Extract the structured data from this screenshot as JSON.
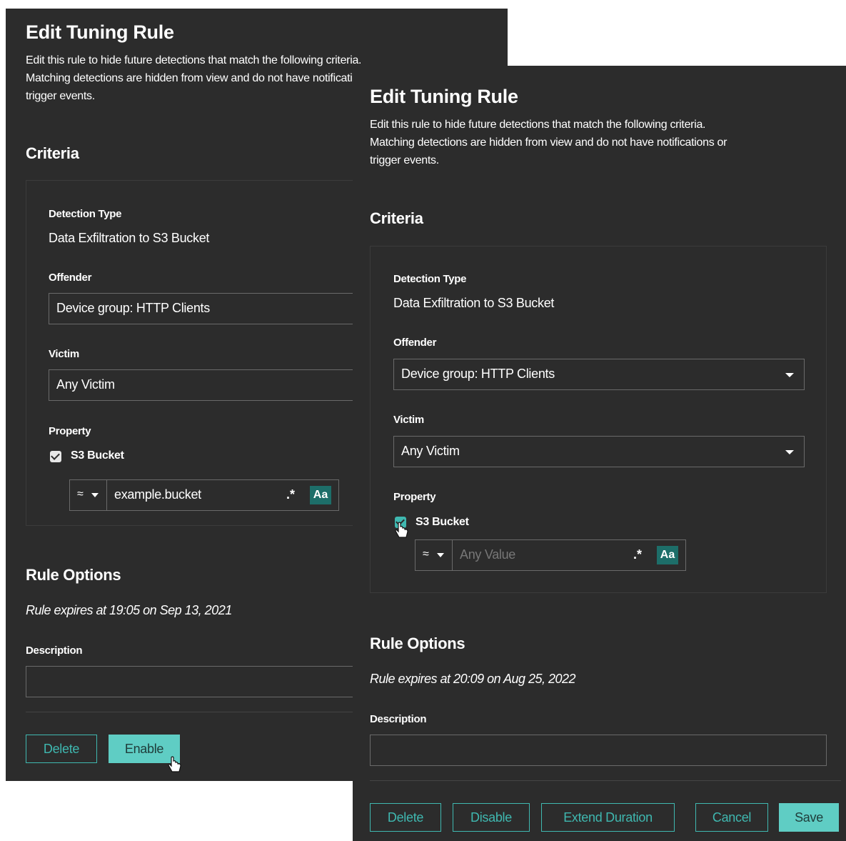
{
  "dialog_back": {
    "title": "Edit Tuning Rule",
    "description_lines": [
      "Edit this rule to hide future detections that match the following criteria.",
      "Matching detections are hidden from view and do not have notifications or",
      "trigger events."
    ],
    "criteria_heading": "Criteria",
    "detection_type_label": "Detection Type",
    "detection_type_value": "Data Exfiltration to S3 Bucket",
    "offender_label": "Offender",
    "offender_value": "Device group: HTTP Clients",
    "victim_label": "Victim",
    "victim_value": "Any Victim",
    "property_label": "Property",
    "property_name": "S3 Bucket",
    "property_checked": true,
    "operator": "≈",
    "property_value": "example.bucket",
    "regex_toggle": ".*",
    "case_toggle": "Aa",
    "rule_options_heading": "Rule Options",
    "expires_text": "Rule expires at 19:05 on Sep 13, 2021",
    "description_label": "Description",
    "buttons": {
      "delete": "Delete",
      "enable": "Enable"
    }
  },
  "dialog_front": {
    "title": "Edit Tuning Rule",
    "description_lines": [
      "Edit this rule to hide future detections that match the following criteria.",
      "Matching detections are hidden from view and do not have notifications or",
      "trigger events."
    ],
    "criteria_heading": "Criteria",
    "detection_type_label": "Detection Type",
    "detection_type_value": "Data Exfiltration to S3 Bucket",
    "offender_label": "Offender",
    "offender_value": "Device group: HTTP Clients",
    "victim_label": "Victim",
    "victim_value": "Any Victim",
    "property_label": "Property",
    "property_name": "S3 Bucket",
    "property_checked": true,
    "operator": "≈",
    "property_placeholder": "Any Value",
    "regex_toggle": ".*",
    "case_toggle": "Aa",
    "rule_options_heading": "Rule Options",
    "expires_text": "Rule expires at 20:09 on Aug 25, 2022",
    "description_label": "Description",
    "buttons": {
      "delete": "Delete",
      "disable": "Disable",
      "extend": "Extend Duration",
      "cancel": "Cancel",
      "save": "Save"
    }
  },
  "colors": {
    "panel_bg": "#2c2c2c",
    "accent": "#3fb8b0",
    "primary_button": "#5fcdc4",
    "case_toggle_bg": "#1d6e69"
  }
}
